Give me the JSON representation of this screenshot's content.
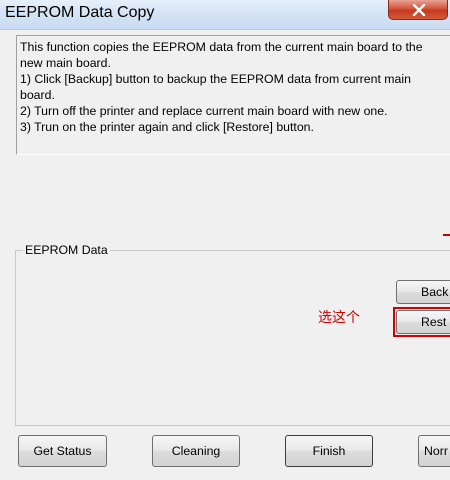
{
  "window": {
    "title": "EEPROM Data Copy"
  },
  "description": {
    "lines": [
      "This function copies the EEPROM data from the current main board to the",
      "new main board.",
      "1) Click [Backup] button to backup the EEPROM data from current main",
      "board.",
      "2) Turn off the printer and replace current main board with new one.",
      "3) Trun on the printer again and click [Restore] button."
    ]
  },
  "eeprom_group": {
    "label": "EEPROM Data",
    "backup_label": "Back",
    "restore_label": "Rest"
  },
  "annotation": {
    "text": "选这个",
    "color": "#d40000"
  },
  "footer": {
    "get_status_label": "Get Status",
    "cleaning_label": "Cleaning",
    "finish_label": "Finish",
    "normal_label": "Norr"
  },
  "icons": {
    "close": "close-icon"
  }
}
